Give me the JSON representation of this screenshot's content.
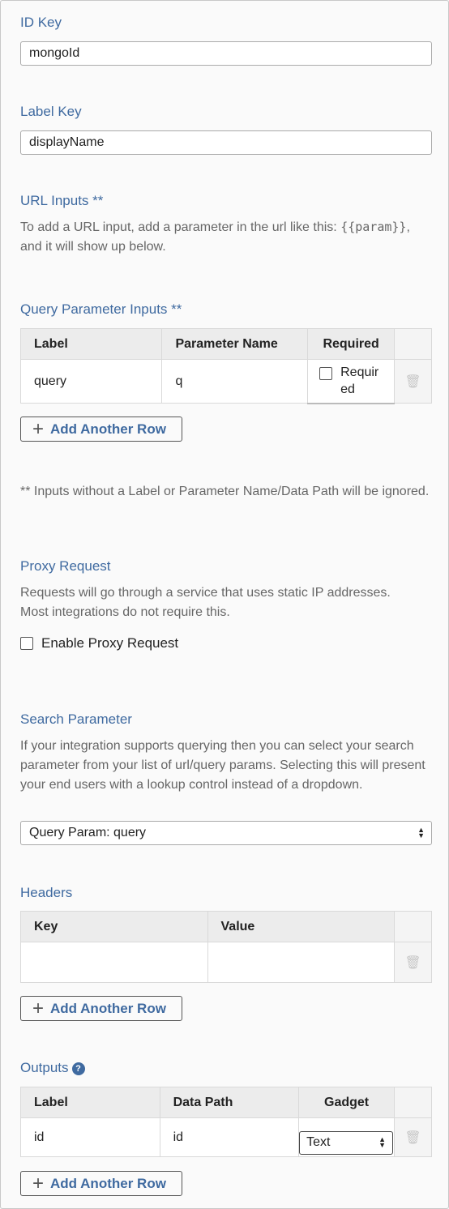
{
  "id_key": {
    "label": "ID Key",
    "value": "mongoId"
  },
  "label_key": {
    "label": "Label Key",
    "value": "displayName"
  },
  "url_inputs": {
    "label": "URL Inputs **",
    "desc_before": "To add a URL input, add a parameter in the url like this: ",
    "code": "{{param}}",
    "desc_after": ", and it will show up below."
  },
  "query_params": {
    "label": "Query Parameter Inputs **",
    "columns": [
      "Label",
      "Parameter Name",
      "Required"
    ],
    "rows": [
      {
        "label": "query",
        "param": "q",
        "required_text": "Required",
        "required": false
      }
    ],
    "add_button": "Add Another Row"
  },
  "note": "** Inputs without a Label or Parameter Name/Data Path will be ignored.",
  "proxy": {
    "label": "Proxy Request",
    "desc1": "Requests will go through a service that uses static IP addresses.",
    "desc2": "Most integrations do not require this.",
    "checkbox_label": "Enable Proxy Request",
    "checked": false
  },
  "search_param": {
    "label": "Search Parameter",
    "desc": "If your integration supports querying then you can select your search parameter from your list of url/query params. Selecting this will present your end users with a lookup control instead of a dropdown.",
    "selected": "Query Param: query"
  },
  "headers": {
    "label": "Headers",
    "columns": [
      "Key",
      "Value"
    ],
    "rows": [
      {
        "key": "",
        "value": ""
      }
    ],
    "add_button": "Add Another Row"
  },
  "outputs": {
    "label": "Outputs",
    "help_icon": "question-circle-icon",
    "columns": [
      "Label",
      "Data Path",
      "Gadget"
    ],
    "rows": [
      {
        "label": "id",
        "path": "id",
        "gadget": "Text"
      }
    ],
    "add_button": "Add Another Row"
  },
  "colors": {
    "accent": "#3f6aa0",
    "header_bg": "#ececec",
    "border": "#d9d9d9"
  }
}
